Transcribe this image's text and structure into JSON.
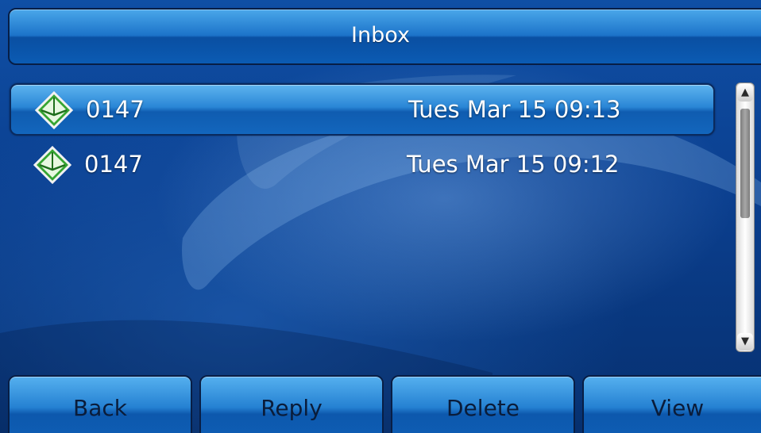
{
  "header": {
    "title": "Inbox"
  },
  "messages": [
    {
      "number": "0147",
      "time": "Tues Mar 15 09:13",
      "selected": true,
      "icon": "envelope-icon"
    },
    {
      "number": "0147",
      "time": "Tues Mar 15 09:12",
      "selected": false,
      "icon": "envelope-icon"
    }
  ],
  "softkeys": {
    "back": "Back",
    "reply": "Reply",
    "delete": "Delete",
    "view": "View"
  },
  "scrollbar": {
    "up_arrow": "▲",
    "down_arrow": "▼"
  },
  "colors": {
    "background": "#0b3f8f",
    "accent": "#2581d2",
    "icon_green": "#2e9b2b"
  }
}
